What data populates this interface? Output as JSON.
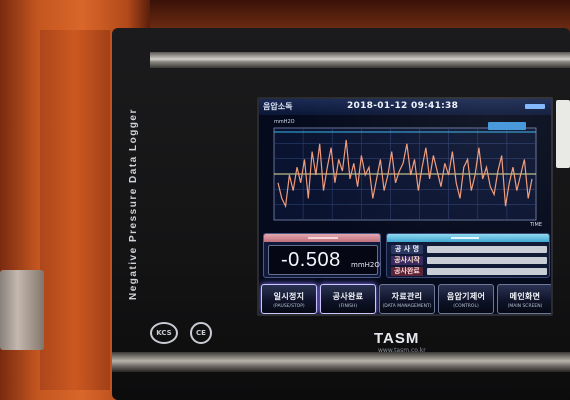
{
  "device": {
    "side_label": "Negative Pressure Data Logger",
    "brand": "TASM",
    "brand_url": "www.tasm.co.kr",
    "badge_left": "KCS",
    "badge_right": "CE"
  },
  "screen": {
    "title": "음압소독",
    "datetime": "2018-01-12 09:41:38",
    "chart": {
      "unit_label": "mmH2O",
      "time_label": "TIME",
      "line_color": "#f09a7a",
      "upper_limit_color": "#38b6ea",
      "lower_limit_color": "#e8e79a"
    },
    "reading": {
      "value": "-0.508",
      "unit": "mmH2O"
    },
    "info": {
      "rows": [
        {
          "label": "공 사 명"
        },
        {
          "label": "공사시작"
        },
        {
          "label": "공사완료"
        }
      ]
    },
    "buttons": [
      {
        "label": "일시정지",
        "sub": "(PAUSE/STOP)"
      },
      {
        "label": "공사완료",
        "sub": "(FINISH)"
      },
      {
        "label": "자료관리",
        "sub": "(DATA MANAGEMENT)"
      },
      {
        "label": "음압기제어",
        "sub": "(CONTROL)"
      },
      {
        "label": "메인화면",
        "sub": "(MAIN SCREEN)"
      }
    ]
  },
  "chart_data": {
    "type": "line",
    "xlabel": "TIME",
    "ylabel": "mmH2O",
    "series": [
      {
        "values": [
          0.4,
          0.2,
          0.1,
          0.5,
          0.3,
          0.6,
          0.4,
          0.7,
          0.2,
          0.8,
          0.5,
          0.9,
          0.3,
          0.6,
          0.85,
          0.4,
          0.7,
          0.55,
          0.95,
          0.45,
          0.65,
          0.35,
          0.75,
          0.5,
          0.6,
          0.2,
          0.45,
          0.7,
          0.3,
          0.5,
          0.8,
          0.4,
          0.55,
          0.65,
          0.9,
          0.5,
          0.7,
          0.3,
          0.6,
          0.85,
          0.45,
          0.75,
          0.55,
          0.35,
          0.65,
          0.5,
          0.8,
          0.4,
          0.2,
          0.6,
          0.7,
          0.3,
          0.5,
          0.85,
          0.45,
          0.6,
          0.35,
          0.25,
          0.55,
          0.75,
          0.1,
          0.4,
          0.6,
          0.3,
          0.5,
          0.7,
          0.2,
          0.45
        ]
      }
    ]
  }
}
